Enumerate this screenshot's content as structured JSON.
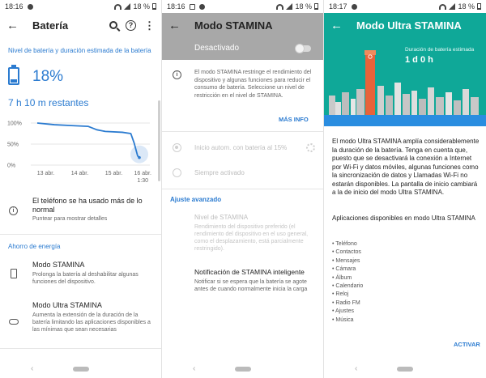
{
  "status_bars": [
    {
      "time": "18:16",
      "battery": "18 %"
    },
    {
      "time": "18:16",
      "battery": "18 %"
    },
    {
      "time": "18:17",
      "battery": "18 %"
    }
  ],
  "battery_screen": {
    "title": "Batería",
    "section_header": "Nivel de batería y duración estimada de la batería",
    "percent": "18%",
    "remaining": "7 h  10 m restantes",
    "usage_title": "El teléfono se ha usado más de lo normal",
    "usage_subtitle": "Puntear para mostrar detalles",
    "savings_header": "Ahorro de energía",
    "stamina_title": "Modo STAMINA",
    "stamina_desc": "Prolonga la batería al deshabilitar algunas funciones del dispositivo.",
    "ultra_title": "Modo Ultra STAMINA",
    "ultra_desc": "Aumenta la extensión de la duración de la batería limitando las aplicaciones disponibles a las mínimas que sean necesarias"
  },
  "chart_data": {
    "type": "line",
    "y_tick_labels": [
      "100%",
      "50%",
      "0%"
    ],
    "x_tick_labels": [
      "13 abr.",
      "14 abr.",
      "15 abr.",
      "16 abr.",
      "1:30"
    ],
    "ylim": [
      0,
      100
    ],
    "points": [
      {
        "x": 0.0,
        "y": 100
      },
      {
        "x": 0.5,
        "y": 96
      },
      {
        "x": 1.0,
        "y": 94
      },
      {
        "x": 1.5,
        "y": 92
      },
      {
        "x": 1.75,
        "y": 84
      },
      {
        "x": 2.0,
        "y": 80
      },
      {
        "x": 2.5,
        "y": 78
      },
      {
        "x": 2.75,
        "y": 75
      },
      {
        "x": 2.85,
        "y": 52
      },
      {
        "x": 2.95,
        "y": 22
      },
      {
        "x": 3.0,
        "y": 18
      }
    ],
    "grid": true
  },
  "stamina_screen": {
    "title": "Modo STAMINA",
    "toggle_label": "Desactivado",
    "toggle_on": false,
    "info_text": "El modo STAMINA restringe el rendimiento del dispositivo y algunas funciones para reducir el consumo de batería. Seleccione un nivel de restricción en el nivel de STAMINA.",
    "more_info": "MÁS INFO",
    "option_auto": "Inicio autom. con batería al 15%",
    "option_always": "Siempre activado",
    "advanced_header": "Ajuste avanzado",
    "level_title": "Nivel de STAMINA",
    "level_desc": "Rendimiento del dispositivo preferido (el rendimiento del dispositivo en el uso general, como el desplazamiento, está parcialmente restringido).",
    "notif_title": "Notificación de STAMINA inteligente",
    "notif_desc": "Notificar si se espera que la batería se agote antes de cuando normalmente inicia la carga"
  },
  "ultra_screen": {
    "title": "Modo Ultra STAMINA",
    "duration_label": "Duración de batería estimada",
    "duration_value": "1 d 0 h",
    "description": "El modo Ultra STAMINA amplía considerablemente la duración de la batería. Tenga en cuenta que, puesto que se desactivará la conexión a Internet por Wi-Fi y datos móviles, algunas funciones como la sincronización de datos y Llamadas Wi-Fi no estarán disponibles. La pantalla de inicio cambiará a la de inicio del modo Ultra STAMINA.",
    "apps_title": "Aplicaciones disponibles en modo Ultra STAMINA",
    "apps": [
      "• Teléfono",
      "• Contactos",
      "• Mensajes",
      "• Cámara",
      "• Álbum",
      "• Calendario",
      "• Reloj",
      "• Radio FM",
      "• Ajustes",
      "• Música"
    ],
    "activate": "ACTIVAR"
  },
  "colors": {
    "accent": "#2b7bd0",
    "teal": "#0fa898",
    "tower": "#e8633a",
    "gray_header": "#a8a8a8"
  },
  "icons": {
    "back": "←",
    "help": "?",
    "more": "⋮",
    "nav_back": "‹"
  }
}
